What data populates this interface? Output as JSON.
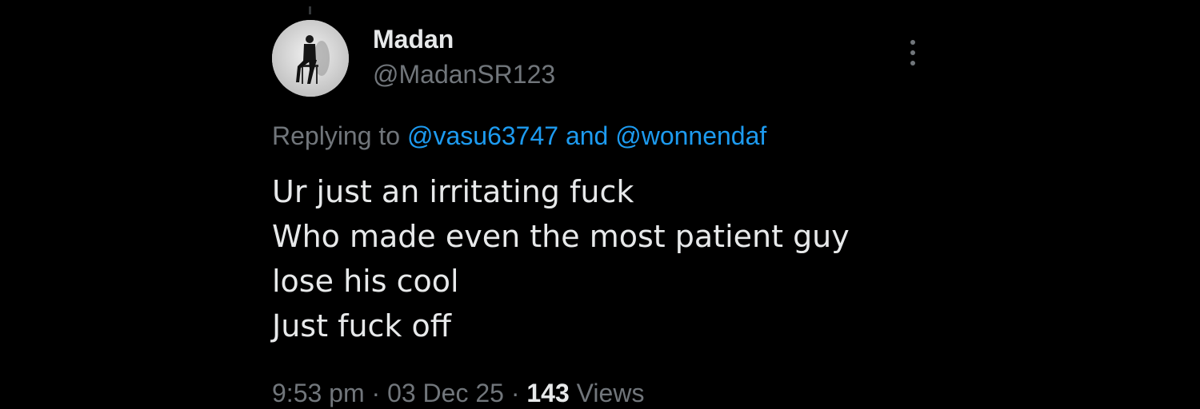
{
  "colors": {
    "background": "#000000",
    "primary_text": "#e7e9ea",
    "secondary_text": "#71767b",
    "link": "#1d9bf0"
  },
  "tweet": {
    "author": {
      "display_name": "Madan",
      "handle": "@MadanSR123",
      "avatar_icon": "avatar-photo"
    },
    "more_icon": "more-options-icon",
    "replying": {
      "prefix": "Replying to",
      "user1": "@vasu63747",
      "conjunction": "and",
      "user2": "@wonnendaf"
    },
    "body_lines": [
      "Ur just an irritating fuck",
      "Who made even the most patient guy",
      "lose his cool",
      "Just fuck off"
    ],
    "meta": {
      "time": "9:53 pm",
      "separator": "·",
      "date": "03 Dec 25",
      "views_count": "143",
      "views_label": "Views"
    }
  }
}
